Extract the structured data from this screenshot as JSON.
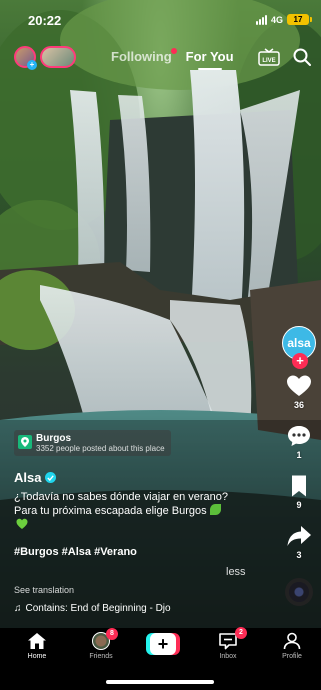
{
  "status_bar": {
    "time": "20:22",
    "network": "4G",
    "battery": "17"
  },
  "top_nav": {
    "tabs": [
      {
        "label": "Following",
        "active": false,
        "has_dot": true
      },
      {
        "label": "For You",
        "active": true
      }
    ],
    "live_label": "LIVE",
    "live_avatar_plus": "+"
  },
  "creator": {
    "avatar_text": "alsa",
    "follow_symbol": "+"
  },
  "actions": {
    "likes": "36",
    "comments": "1",
    "bookmarks": "9",
    "shares": "3"
  },
  "post": {
    "location": {
      "name": "Burgos",
      "subtitle": "3352 people posted about this place"
    },
    "author": "Alsa",
    "caption": "¿Todavía no sabes dónde viajar en verano? Para tu próxima escapada elige Burgos",
    "hashtags": "#Burgos #Alsa #Verano",
    "less_label": "less",
    "see_translation": "See translation",
    "music": "Contains: End of Beginning - Djo"
  },
  "bottom_nav": {
    "tabs": [
      {
        "label": "Home",
        "active": true
      },
      {
        "label": "Friends",
        "badge": "8"
      },
      {
        "label": "",
        "create": true,
        "symbol": "+"
      },
      {
        "label": "Inbox",
        "badge": "2"
      },
      {
        "label": "Profile"
      }
    ]
  },
  "colors": {
    "accent_red": "#fe2c55",
    "accent_cyan": "#25f4ee",
    "creator_blue": "#3db9e6",
    "location_green": "#18b87a"
  }
}
